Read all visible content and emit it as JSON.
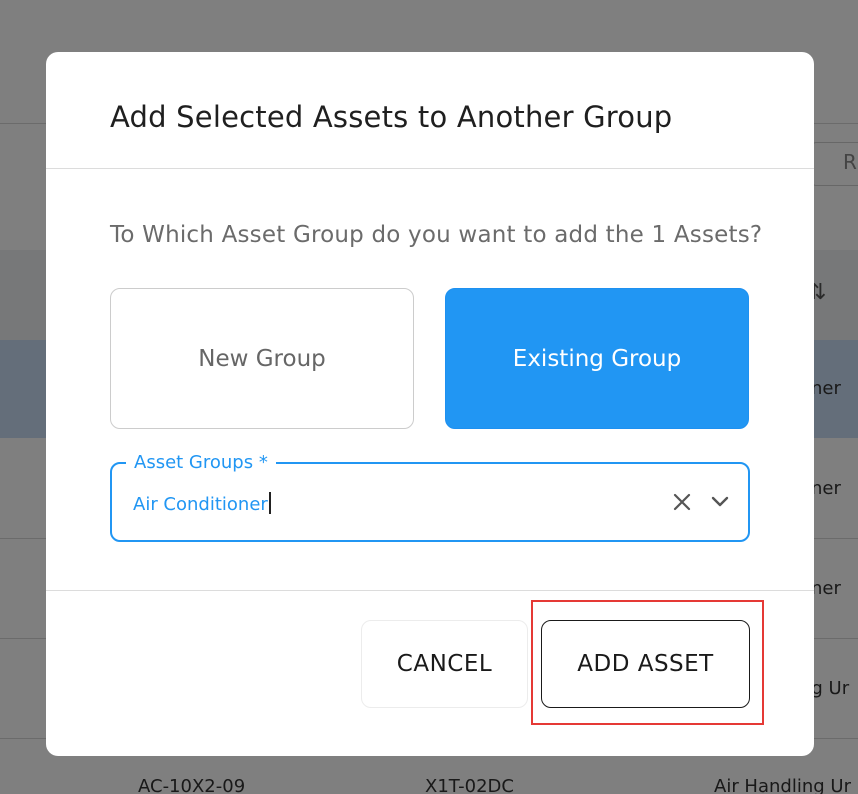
{
  "background": {
    "table_right_column": [
      "oner",
      "oner",
      "oner",
      "ng Ur"
    ],
    "bottom_row": [
      "AC-10X2-09",
      "X1T-02DC",
      "Air Handling Ur"
    ],
    "search_letter": "R",
    "sort_icon": "sort-icon"
  },
  "modal": {
    "title": "Add Selected Assets to Another Group",
    "question": "To Which Asset Group do you want to add the 1 Assets?",
    "choices": {
      "new_group": "New Group",
      "existing_group": "Existing Group",
      "selected": "existing_group"
    },
    "asset_groups_field": {
      "label": "Asset Groups *",
      "value": "Air Conditioner"
    },
    "buttons": {
      "cancel": "CANCEL",
      "add_asset": "ADD ASSET"
    }
  },
  "colors": {
    "accent": "#2196f3",
    "highlight": "#e53935",
    "overlay": "rgba(0,0,0,0.5)"
  }
}
